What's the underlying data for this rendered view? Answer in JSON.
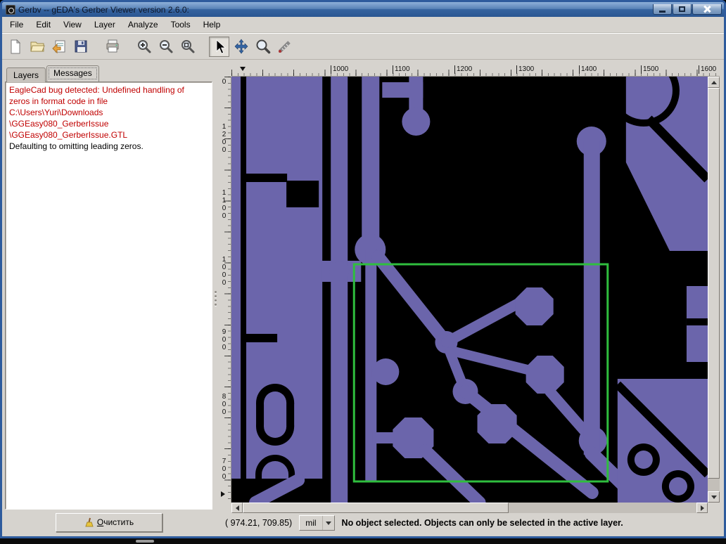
{
  "window": {
    "title": "Gerbv -- gEDA's Gerber Viewer version 2.6.0:"
  },
  "menu": {
    "items": [
      "File",
      "Edit",
      "View",
      "Layer",
      "Analyze",
      "Tools",
      "Help"
    ]
  },
  "toolbar": {
    "buttons": [
      "new",
      "open",
      "revert",
      "save",
      "print",
      "zoom-in",
      "zoom-out",
      "zoom-fit",
      "pointer",
      "pan",
      "zoom",
      "measure"
    ],
    "active_tool": "pointer"
  },
  "sidebar": {
    "tabs": [
      {
        "label": "Layers",
        "active": false
      },
      {
        "label": "Messages",
        "active": true
      }
    ],
    "messages": [
      {
        "text": "EagleCad bug detected: Undefined handling of"
      },
      {
        "text": "zeros in format code in file"
      },
      {
        "text": "C:\\Users\\Yuri\\Downloads"
      },
      {
        "text": "\\GGEasy080_GerberIssue"
      },
      {
        "text": "\\GGEasy080_GerberIssue.GTL"
      },
      {
        "text": "Defaulting to omitting leading zeros."
      }
    ],
    "clear_button": {
      "mnemonic": "О",
      "rest": "чистить"
    }
  },
  "rulers": {
    "horizontal": [
      "1000",
      "1100",
      "1200",
      "1300",
      "1400",
      "1500",
      "1600"
    ],
    "vertical": [
      "0",
      "1200",
      "1100",
      "1000",
      "900",
      "800",
      "700"
    ]
  },
  "statusbar": {
    "coordinates": "( 974.21,  709.85)",
    "units": "mil",
    "message": "No object selected. Objects can only be selected in the active layer."
  },
  "colors": {
    "copper": "#6b65ab",
    "selection": "#2fbe3e",
    "canvas_background": "#000000",
    "message_error": "#c00000",
    "titlebar": "#35639f"
  }
}
